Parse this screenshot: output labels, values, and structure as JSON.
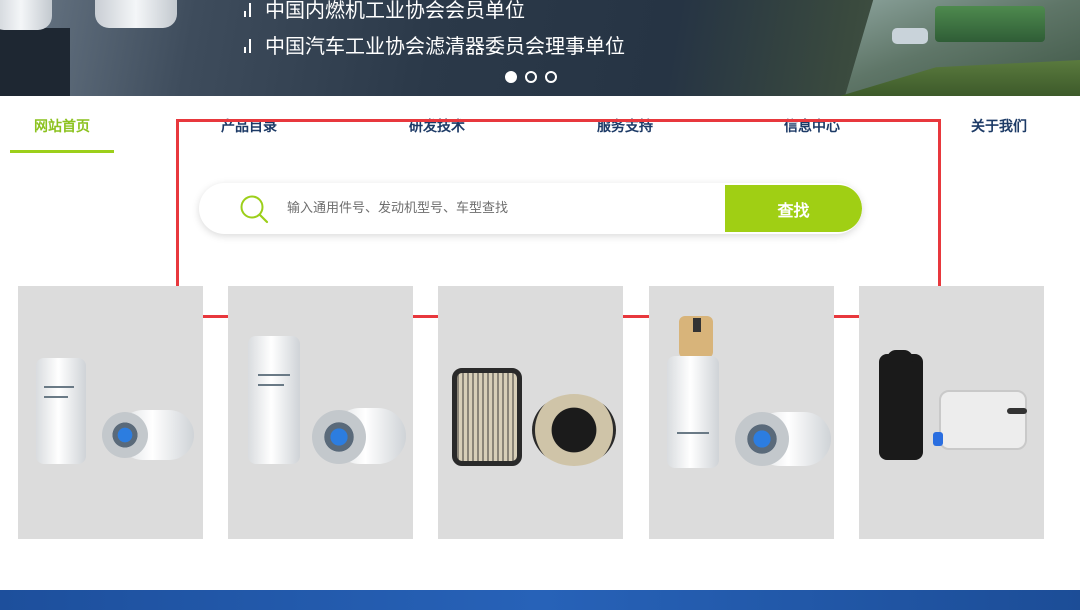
{
  "banner": {
    "lines": [
      "中国内燃机工业协会会员单位",
      "中国汽车工业协会滤清器委员会理事单位"
    ],
    "carousel": {
      "count": 3,
      "active_index": 0
    }
  },
  "nav": {
    "items": [
      {
        "label": "网站首页",
        "active": true
      },
      {
        "label": "产品目录",
        "active": false
      },
      {
        "label": "研发技术",
        "active": false
      },
      {
        "label": "服务支持",
        "active": false
      },
      {
        "label": "信息中心",
        "active": false
      },
      {
        "label": "关于我们",
        "active": false
      }
    ]
  },
  "search": {
    "placeholder": "输入通用件号、发动机型号、车型查找",
    "value": "",
    "button_label": "查找"
  },
  "colors": {
    "accent": "#9ccf1a",
    "nav_text": "#1c3a66",
    "highlight": "#e8383d",
    "bottom_strip": "#2762b8"
  },
  "products": [
    {
      "icon": "fuel-filter-pair"
    },
    {
      "icon": "fuel-filter-pair-tall"
    },
    {
      "icon": "air-filter-pair"
    },
    {
      "icon": "fuel-water-separator"
    },
    {
      "icon": "air-cleaner-assembly"
    }
  ]
}
